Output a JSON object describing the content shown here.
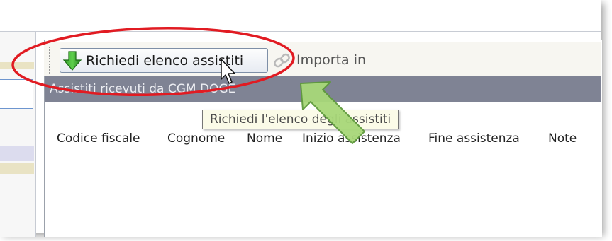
{
  "toolbar": {
    "request_button_label": "Richiedi elenco assistiti",
    "import_label": "Importa in"
  },
  "section": {
    "title": "Assistiti ricevuti da CGM DOGE"
  },
  "tooltip": {
    "text": "Richiedi l'elenco degli assistiti"
  },
  "table": {
    "columns": [
      "Codice fiscale",
      "Cognome",
      "Nome",
      "Inizio assistenza",
      "Fine assistenza",
      "Note"
    ],
    "rows": []
  },
  "icons": {
    "request": "green-down-arrow-icon",
    "import": "chain-link-icon",
    "pointer": "mouse-cursor-icon",
    "callout_arrow": "green-arrow-icon"
  },
  "colors": {
    "highlight_ellipse": "#e11b22",
    "callout_arrow": "#a8d879",
    "section_bar": "#7f8394",
    "tooltip_bg": "#fbfbe8"
  }
}
